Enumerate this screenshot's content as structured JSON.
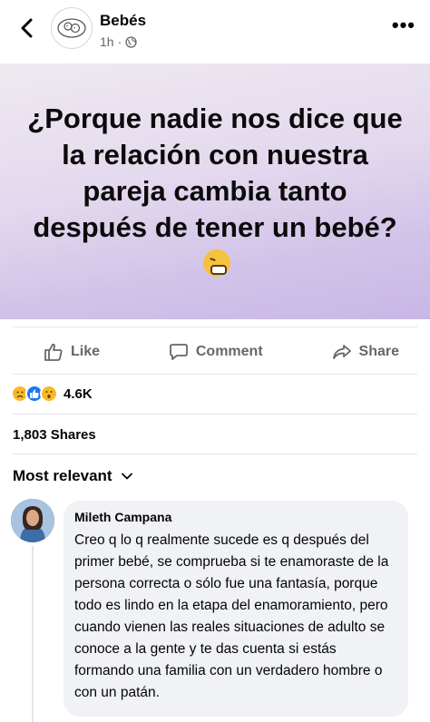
{
  "header": {
    "page_name": "Bebés",
    "time": "1h",
    "separator": "·"
  },
  "post": {
    "text": "¿Porque nadie nos dice que la relación con nuestra pareja cambia tanto después de tener un bebé?",
    "emoji_icon": "tired-face-emoji"
  },
  "actions": {
    "like": "Like",
    "comment": "Comment",
    "share": "Share"
  },
  "reactions": {
    "icons": [
      "sad-reaction-icon",
      "like-reaction-icon",
      "wow-reaction-icon"
    ],
    "count": "4.6K"
  },
  "shares": "1,803 Shares",
  "sort": {
    "label": "Most relevant"
  },
  "comment": {
    "author": "Mileth Campana",
    "text": "Creo q lo q realmente sucede es q después del primer bebé, se comprueba si te enamoraste de la persona correcta o sólo fue una fantasía, porque todo es lindo en la etapa del enamoramiento, pero cuando vienen las reales situaciones de adulto se conoce a la gente y te das cuenta si estás formando una familia con un verdadero hombre o con un patán."
  },
  "colors": {
    "secondary_text": "#65676b",
    "like_blue": "#1877f2",
    "reaction_yellow": "#f7b928",
    "bubble_bg": "#f0f2f5"
  }
}
